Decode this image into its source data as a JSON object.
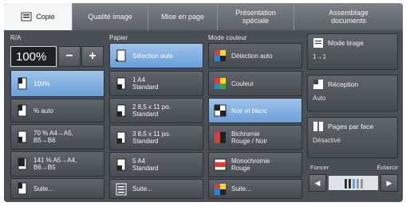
{
  "tabs": [
    {
      "label": "Copie",
      "active": true
    },
    {
      "label": "Qualité image",
      "active": false
    },
    {
      "label": "Mise en page",
      "active": false
    },
    {
      "label": "Présentation\nspéciale",
      "active": false
    },
    {
      "label": "Assemblage\ndocuments",
      "active": false
    }
  ],
  "zoom": {
    "section_label": "R/A",
    "value": "100%",
    "minus": "−",
    "plus": "+",
    "options": [
      {
        "label": "100%",
        "selected": true
      },
      {
        "label": "% auto",
        "selected": false
      },
      {
        "label": "70 % A4→A5,\nB5→B6",
        "selected": false
      },
      {
        "label": "141 % A5→A4,\nB6→B5",
        "selected": false
      },
      {
        "label": "Suite...",
        "selected": false
      }
    ]
  },
  "paper": {
    "section_label": "Papier",
    "options": [
      {
        "label": "Sélection auto",
        "selected": true
      },
      {
        "label": "1 A4\nStandard",
        "selected": false
      },
      {
        "label": "2 8,5 x 11 po.\nStandard",
        "selected": false
      },
      {
        "label": "3 8,5 x 11 po.\nStandard",
        "selected": false
      },
      {
        "label": "5 A4\nStandard",
        "selected": false
      },
      {
        "label": "Suite...",
        "selected": false
      }
    ]
  },
  "color_mode": {
    "section_label": "Mode couleur",
    "options": [
      {
        "label": "Détection auto",
        "selected": false
      },
      {
        "label": "Couleur",
        "selected": false
      },
      {
        "label": "Noir et blanc",
        "selected": true
      },
      {
        "label": "Bichromie\nRouge / Noir",
        "selected": false
      },
      {
        "label": "Monochromie\nRouge",
        "selected": false
      },
      {
        "label": "Suite...",
        "selected": false
      }
    ]
  },
  "right_panel": {
    "print_mode": {
      "title": "Mode tirage",
      "value": "1→1"
    },
    "reduction": {
      "title": "Réception",
      "value": "Auto"
    },
    "pages_per_side": {
      "title": "Pages par face",
      "value": "Désactivé"
    },
    "density": {
      "darker": "Foncer",
      "lighter": "Éclaircir",
      "left": "◀",
      "right": "▶"
    }
  },
  "colors": {
    "selected": "#7aa9dc",
    "panel": "#4a4f55"
  }
}
